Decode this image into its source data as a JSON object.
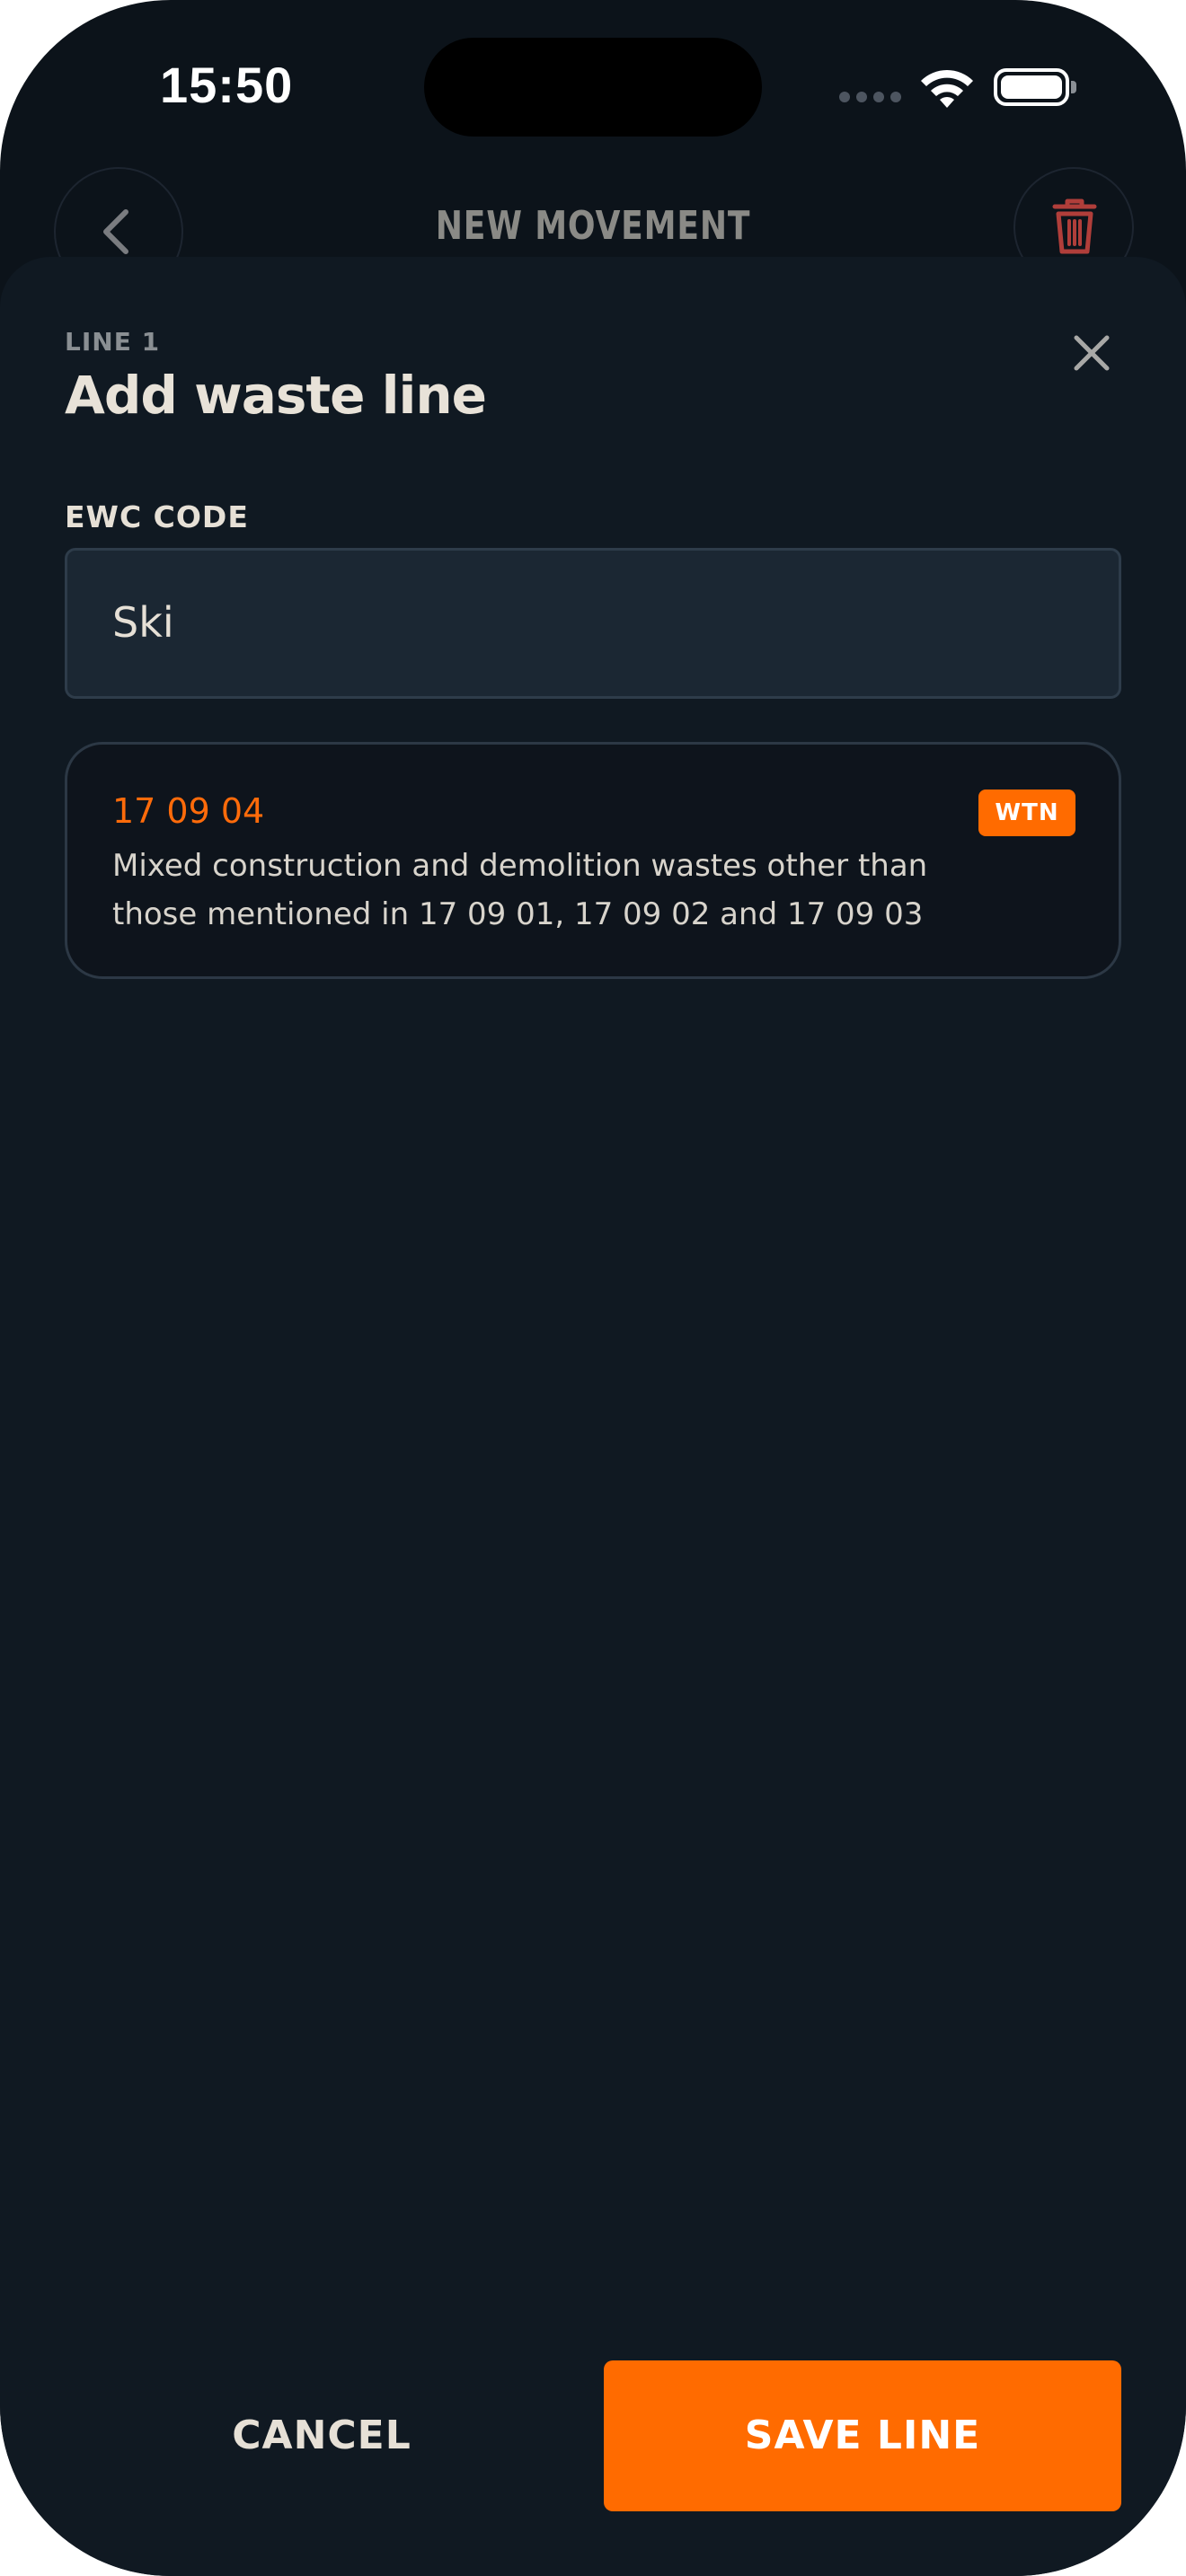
{
  "status_bar": {
    "time": "15:50"
  },
  "header": {
    "title": "NEW MOVEMENT",
    "back_icon": "chevron-left-icon",
    "delete_icon": "trash-icon",
    "delete_color": "#c0433f"
  },
  "sheet": {
    "line_label": "LINE 1",
    "title": "Add waste line",
    "close_icon": "close-icon"
  },
  "ewc_field": {
    "label": "EWC CODE",
    "value": "Ski"
  },
  "results": [
    {
      "code": "17 09 04",
      "badge": "WTN",
      "description": "Mixed construction and demolition wastes other than those mentioned in 17 09 01, 17 09 02 and 17 09 03"
    }
  ],
  "footer": {
    "cancel_label": "CANCEL",
    "save_label": "SAVE LINE"
  },
  "colors": {
    "accent": "#ff6b00",
    "background": "#0c131a",
    "sheet": "#101922"
  }
}
